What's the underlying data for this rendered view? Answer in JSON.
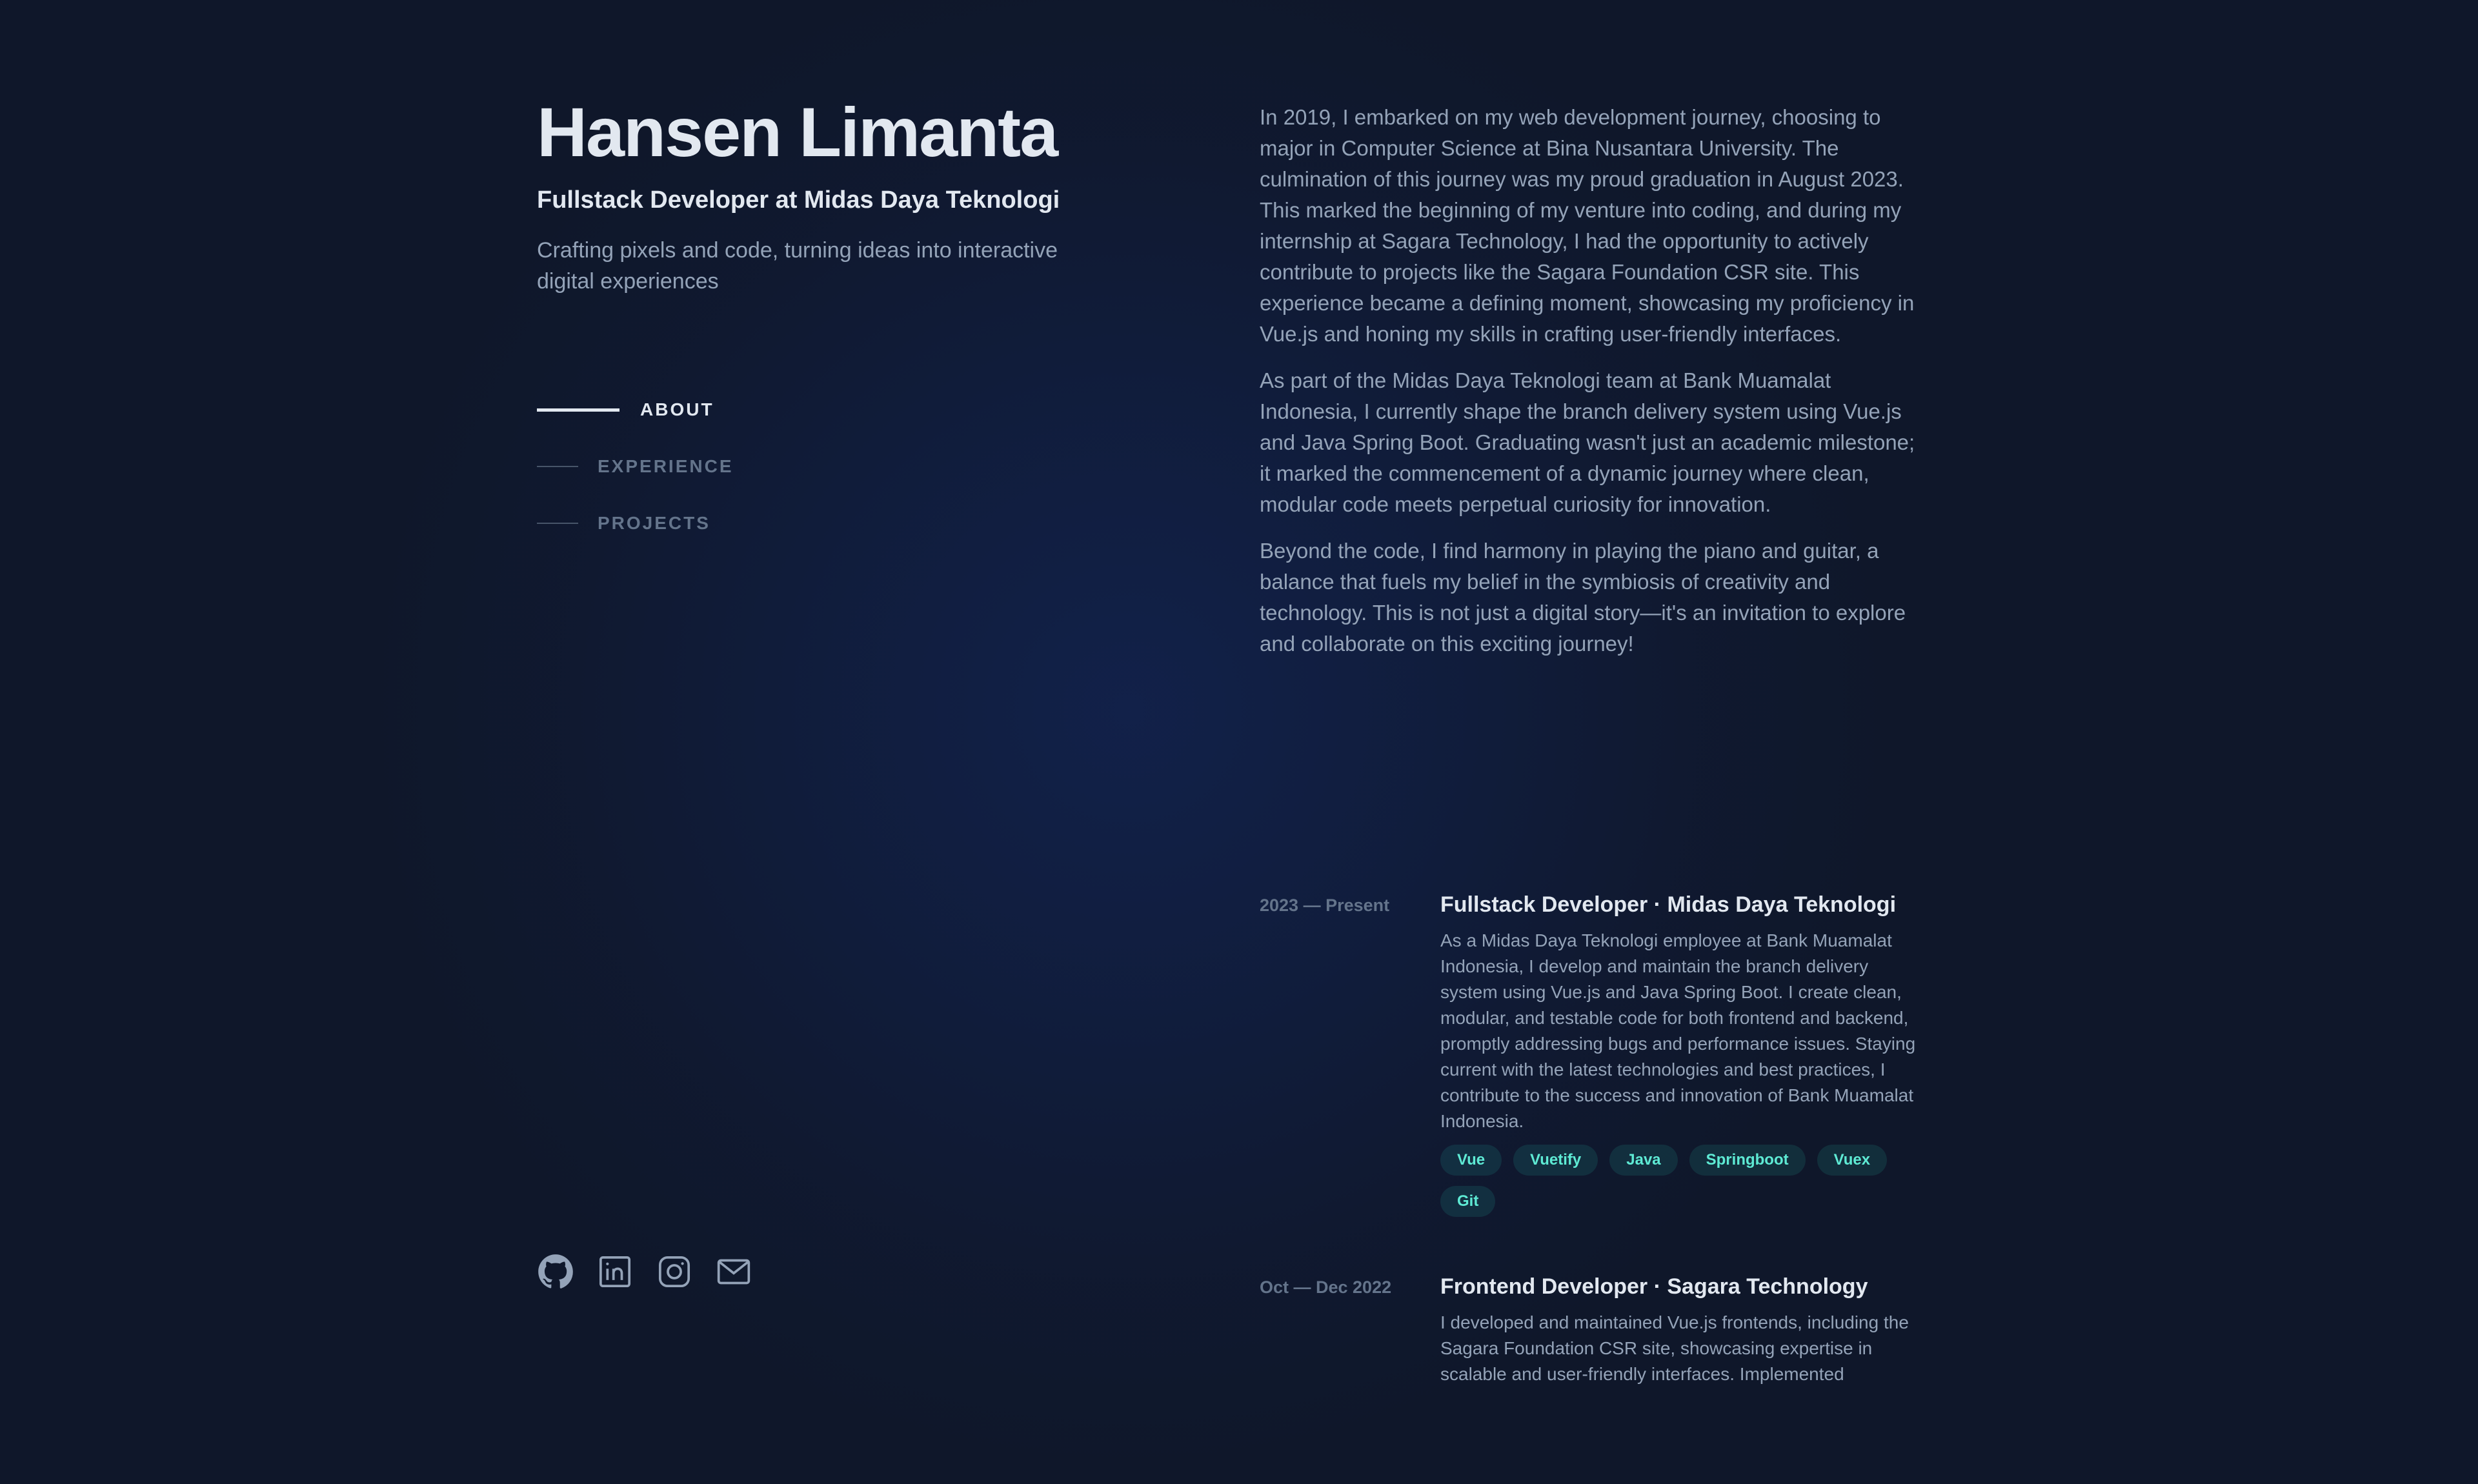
{
  "profile": {
    "name": "Hansen Limanta",
    "role": "Fullstack Developer at Midas Daya Teknologi",
    "tagline": "Crafting pixels and code, turning ideas into interactive digital experiences"
  },
  "nav": {
    "items": [
      {
        "label": "ABOUT",
        "active": true
      },
      {
        "label": "EXPERIENCE",
        "active": false
      },
      {
        "label": "PROJECTS",
        "active": false
      }
    ]
  },
  "socials": [
    {
      "icon": "github-icon"
    },
    {
      "icon": "linkedin-icon"
    },
    {
      "icon": "instagram-icon"
    },
    {
      "icon": "mail-icon"
    }
  ],
  "about": {
    "paragraphs": [
      "In 2019, I embarked on my web development journey, choosing to major in Computer Science at Bina Nusantara University. The culmination of this journey was my proud graduation in August 2023. This marked the beginning of my venture into coding, and during my internship at Sagara Technology, I had the opportunity to actively contribute to projects like the Sagara Foundation CSR site. This experience became a defining moment, showcasing my proficiency in Vue.js and honing my skills in crafting user-friendly interfaces.",
      "As part of the Midas Daya Teknologi team at Bank Muamalat Indonesia, I currently shape the branch delivery system using Vue.js and Java Spring Boot. Graduating wasn't just an academic milestone; it marked the commencement of a dynamic journey where clean, modular code meets perpetual curiosity for innovation.",
      "Beyond the code, I find harmony in playing the piano and guitar, a balance that fuels my belief in the symbiosis of creativity and technology. This is not just a digital story—it's an invitation to explore and collaborate on this exciting journey!"
    ]
  },
  "experience": [
    {
      "date": "2023 — Present",
      "title": "Fullstack Developer · Midas Daya Teknologi",
      "description": "As a Midas Daya Teknologi employee at Bank Muamalat Indonesia, I develop and maintain the branch delivery system using Vue.js and Java Spring Boot. I create clean, modular, and testable code for both frontend and backend, promptly addressing bugs and performance issues. Staying current with the latest technologies and best practices, I contribute to the success and innovation of Bank Muamalat Indonesia.",
      "tags": [
        "Vue",
        "Vuetify",
        "Java",
        "Springboot",
        "Vuex",
        "Git"
      ]
    },
    {
      "date": "Oct — Dec 2022",
      "title": "Frontend Developer · Sagara Technology",
      "description": "I developed and maintained Vue.js frontends, including the Sagara Foundation CSR site, showcasing expertise in scalable and user-friendly interfaces. Implemented",
      "tags": []
    }
  ],
  "colors": {
    "background": "#0f172a",
    "heading": "#e2e8f0",
    "body_text": "#94a3b8",
    "muted": "#64748b",
    "tag_text": "#5eead4",
    "spotlight": "#1d4ed8"
  }
}
